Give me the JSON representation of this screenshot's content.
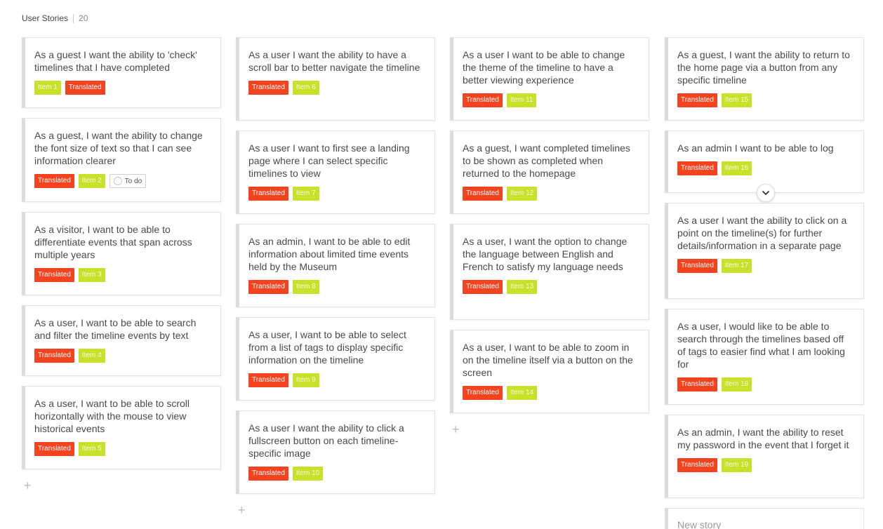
{
  "header": {
    "title": "User Stories",
    "count": "20"
  },
  "tags": {
    "translated": "Translated",
    "todo": "To do"
  },
  "add_symbol": "+",
  "new_story_placeholder": "New story",
  "columns": [
    [
      {
        "title": "As a guest I want the ability to 'check' timelines that I have completed",
        "item": "Item 1"
      },
      {
        "title": "As a guest, I want the ability to change the font size of text so that I can see information clearer",
        "item": "Item 2"
      },
      {
        "title": "As a visitor, I want to be able to differentiate events that span across multiple years",
        "item": "Item 3"
      },
      {
        "title": "As a user, I want to be able to search and filter the timeline events by text",
        "item": "Item 4"
      },
      {
        "title": "As a user, I want to be able to scroll horizontally with the mouse to view historical events",
        "item": "Item 5"
      }
    ],
    [
      {
        "title": "As a user I want the ability to have a scroll bar to better navigate the timeline",
        "item": "Item 6"
      },
      {
        "title": "As a user I want to first see a landing page where I can select specific timelines to view",
        "item": "Item 7"
      },
      {
        "title": "As an admin, I want to be able to edit information about limited time events held by the Museum",
        "item": "Item 8"
      },
      {
        "title": "As a user, I want to be able to select from a list of tags to display specific information on the timeline",
        "item": "Item 9"
      },
      {
        "title": "As a user I want the ability to click a fullscreen button on each timeline-specific image",
        "item": "Item 10"
      }
    ],
    [
      {
        "title": "As a user I want to be able to change the theme of the timeline to have a better viewing experience",
        "item": "Item 11"
      },
      {
        "title": "As a guest, I want completed timelines to be shown as completed when returned to the homepage",
        "item": "Item 12"
      },
      {
        "title": "As a user, I want the option to change the language between English and French to satisfy my language needs",
        "item": "Item 13"
      },
      {
        "title": "As a user, I want to be able to zoom in on the timeline itself via a button on the screen",
        "item": "Item 14"
      }
    ],
    [
      {
        "title": "As a guest, I want the ability to return to the home page via a button from any specific timeline",
        "item": "Item 15"
      },
      {
        "title": "As an admin I want to be able to log",
        "item": "Item 16"
      },
      {
        "title": "As a user I want the ability to click on a point on the timeline(s) for further details/information in a separate page",
        "item": "Item 17"
      },
      {
        "title": "As a user, I would like to be able to search through the timelines based off of tags to easier find what I am looking for",
        "item": "Item 18"
      },
      {
        "title": "As an admin, I want the ability to reset my password in the event that I forget it",
        "item": "Item 19"
      }
    ]
  ]
}
